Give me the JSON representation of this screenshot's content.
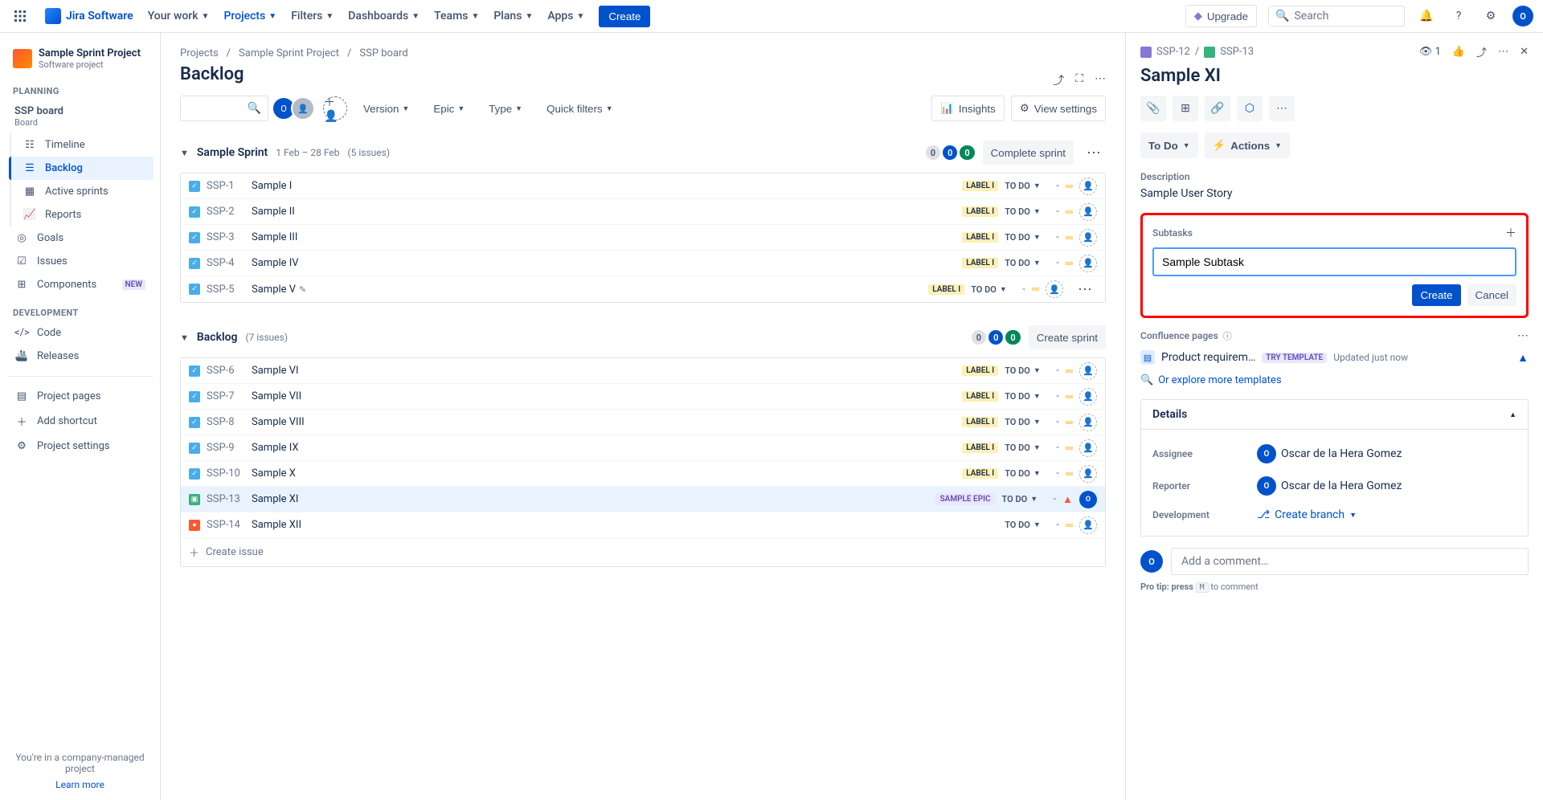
{
  "topnav": {
    "logo": "Jira Software",
    "items": [
      "Your work",
      "Projects",
      "Filters",
      "Dashboards",
      "Teams",
      "Plans",
      "Apps"
    ],
    "active_index": 1,
    "create": "Create",
    "upgrade": "Upgrade",
    "search_placeholder": "Search"
  },
  "sidebar": {
    "project_name": "Sample Sprint Project",
    "project_sub": "Software project",
    "sections": {
      "planning": "PLANNING",
      "development": "DEVELOPMENT"
    },
    "board_label": "SSP board",
    "board_sub": "Board",
    "planning_items": [
      {
        "label": "Timeline",
        "icon": "📅"
      },
      {
        "label": "Backlog",
        "icon": "☰",
        "selected": true
      },
      {
        "label": "Active sprints",
        "icon": "▥"
      },
      {
        "label": "Reports",
        "icon": "📈"
      }
    ],
    "goals": "Goals",
    "issues": "Issues",
    "components": "Components",
    "components_badge": "NEW",
    "dev_items": [
      {
        "label": "Code",
        "icon": "</>"
      },
      {
        "label": "Releases",
        "icon": "🚢"
      }
    ],
    "misc_items": [
      {
        "label": "Project pages",
        "icon": "📄"
      },
      {
        "label": "Add shortcut",
        "icon": "＋"
      },
      {
        "label": "Project settings",
        "icon": "⚙"
      }
    ],
    "footer": "You're in a company-managed project",
    "learn_more": "Learn more"
  },
  "crumbs": [
    "Projects",
    "Sample Sprint Project",
    "SSP board"
  ],
  "page_title": "Backlog",
  "toolbar": {
    "version": "Version",
    "epic": "Epic",
    "type": "Type",
    "quick_filters": "Quick filters",
    "insights": "Insights",
    "view_settings": "View settings"
  },
  "sprint": {
    "name": "Sample Sprint",
    "date_range": "1 Feb – 28 Feb",
    "issue_count": "(5 issues)",
    "counts": {
      "todo": "0",
      "inprog": "0",
      "done": "0"
    },
    "action": "Complete sprint",
    "issues": [
      {
        "key": "SSP-1",
        "summary": "Sample I",
        "type": "task",
        "label": "LABEL I",
        "status": "TO DO",
        "prio": "med"
      },
      {
        "key": "SSP-2",
        "summary": "Sample II",
        "type": "task",
        "label": "LABEL I",
        "status": "TO DO",
        "prio": "med"
      },
      {
        "key": "SSP-3",
        "summary": "Sample III",
        "type": "task",
        "label": "LABEL I",
        "status": "TO DO",
        "prio": "med"
      },
      {
        "key": "SSP-4",
        "summary": "Sample IV",
        "type": "task",
        "label": "LABEL I",
        "status": "TO DO",
        "prio": "med"
      },
      {
        "key": "SSP-5",
        "summary": "Sample V",
        "type": "task",
        "label": "LABEL I",
        "status": "TO DO",
        "prio": "med",
        "editable": true,
        "more": true
      }
    ]
  },
  "backlog_section": {
    "name": "Backlog",
    "issue_count": "(7 issues)",
    "counts": {
      "todo": "0",
      "inprog": "0",
      "done": "0"
    },
    "action": "Create sprint",
    "issues": [
      {
        "key": "SSP-6",
        "summary": "Sample VI",
        "type": "task",
        "label": "LABEL I",
        "status": "TO DO",
        "prio": "med"
      },
      {
        "key": "SSP-7",
        "summary": "Sample VII",
        "type": "task",
        "label": "LABEL I",
        "status": "TO DO",
        "prio": "med"
      },
      {
        "key": "SSP-8",
        "summary": "Sample VIII",
        "type": "task",
        "label": "LABEL I",
        "status": "TO DO",
        "prio": "med"
      },
      {
        "key": "SSP-9",
        "summary": "Sample IX",
        "type": "task",
        "label": "LABEL I",
        "status": "TO DO",
        "prio": "med"
      },
      {
        "key": "SSP-10",
        "summary": "Sample X",
        "type": "task",
        "label": "LABEL I",
        "status": "TO DO",
        "prio": "med"
      },
      {
        "key": "SSP-13",
        "summary": "Sample XI",
        "type": "story",
        "epic": "SAMPLE EPIC",
        "status": "TO DO",
        "prio": "hi",
        "assigned": true,
        "selected": true
      },
      {
        "key": "SSP-14",
        "summary": "Sample XII",
        "type": "bug",
        "status": "TO DO",
        "prio": "med"
      }
    ],
    "create_issue": "Create issue"
  },
  "detail": {
    "parent_key": "SSP-12",
    "key": "SSP-13",
    "title": "Sample XI",
    "status": "To Do",
    "actions": "Actions",
    "description_label": "Description",
    "description": "Sample User Story",
    "subtasks_label": "Subtasks",
    "subtask_input": "Sample Subtask",
    "create": "Create",
    "cancel": "Cancel",
    "confluence_label": "Confluence pages",
    "conf_doc": "Product requirem…",
    "try_template": "TRY TEMPLATE",
    "updated": "Updated just now",
    "explore": "Or explore more templates",
    "details_title": "Details",
    "assignee_label": "Assignee",
    "assignee": "Oscar de la Hera Gomez",
    "reporter_label": "Reporter",
    "reporter": "Oscar de la Hera Gomez",
    "development_label": "Development",
    "create_branch": "Create branch",
    "comment_placeholder": "Add a comment…",
    "pro_tip_prefix": "Pro tip: press ",
    "pro_tip_key": "M",
    "pro_tip_suffix": " to comment"
  }
}
